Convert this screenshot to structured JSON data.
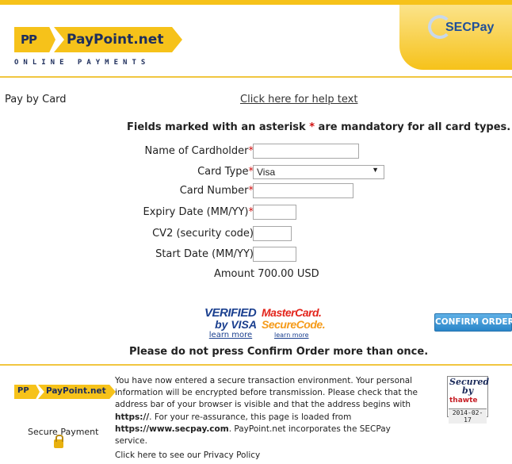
{
  "header": {
    "brand_badge": "PP",
    "brand_name": "PayPoint.net",
    "tagline": "ONLINE PAYMENTS",
    "partner": "SECPay"
  },
  "page": {
    "title": "Pay by Card",
    "help_link": "Click here for help text",
    "mandatory_note_pre": "Fields marked with an asterisk",
    "mandatory_asterisk": "*",
    "mandatory_note_post": "are mandatory for all card types."
  },
  "form": {
    "cardholder_label": "Name of Cardholder",
    "card_type_label": "Card Type",
    "card_type_value": "Visa",
    "card_number_label": "Card Number",
    "expiry_label": "Expiry Date (MM/YY)",
    "cv2_label": "CV2 (security code)",
    "start_date_label": "Start Date (MM/YY)",
    "asterisk": "*",
    "amount": "Amount 700.00 USD"
  },
  "badges": {
    "vbv_line1": "VERIFIED",
    "vbv_line2": "by VISA",
    "vbv_learn": "learn more",
    "msc_line1": "MasterCard.",
    "msc_line2": "SecureCode.",
    "msc_learn": "learn more"
  },
  "actions": {
    "confirm": "CONFIRM ORDER",
    "warning": "Please do not press Confirm Order more than once."
  },
  "footer": {
    "brand_badge": "PP",
    "brand_name": "PayPoint.net",
    "secure_payment": "Secure Payment",
    "text_1": "You have now entered a secure transaction environment. Your personal information will be encrypted before transmission. Please check that the address bar of your browser is visible and that the address begins with",
    "https": "https://",
    "text_2": ". For your re-assurance, this page is loaded from",
    "secpay_url": "https://www.secpay.com",
    "text_3": ". PayPoint.net incorporates the SECPay service.",
    "privacy_link": "Click here",
    "privacy_text": "to see our Privacy Policy",
    "seal_secured": "Secured",
    "seal_by": "by",
    "seal_brand": "thawte",
    "seal_date": "2014-02-17"
  },
  "colors": {
    "brand_yellow": "#f6c21a",
    "brand_navy": "#1e2e5c",
    "confirm_blue": "#2a86c9",
    "asterisk_red": "#d01010"
  }
}
